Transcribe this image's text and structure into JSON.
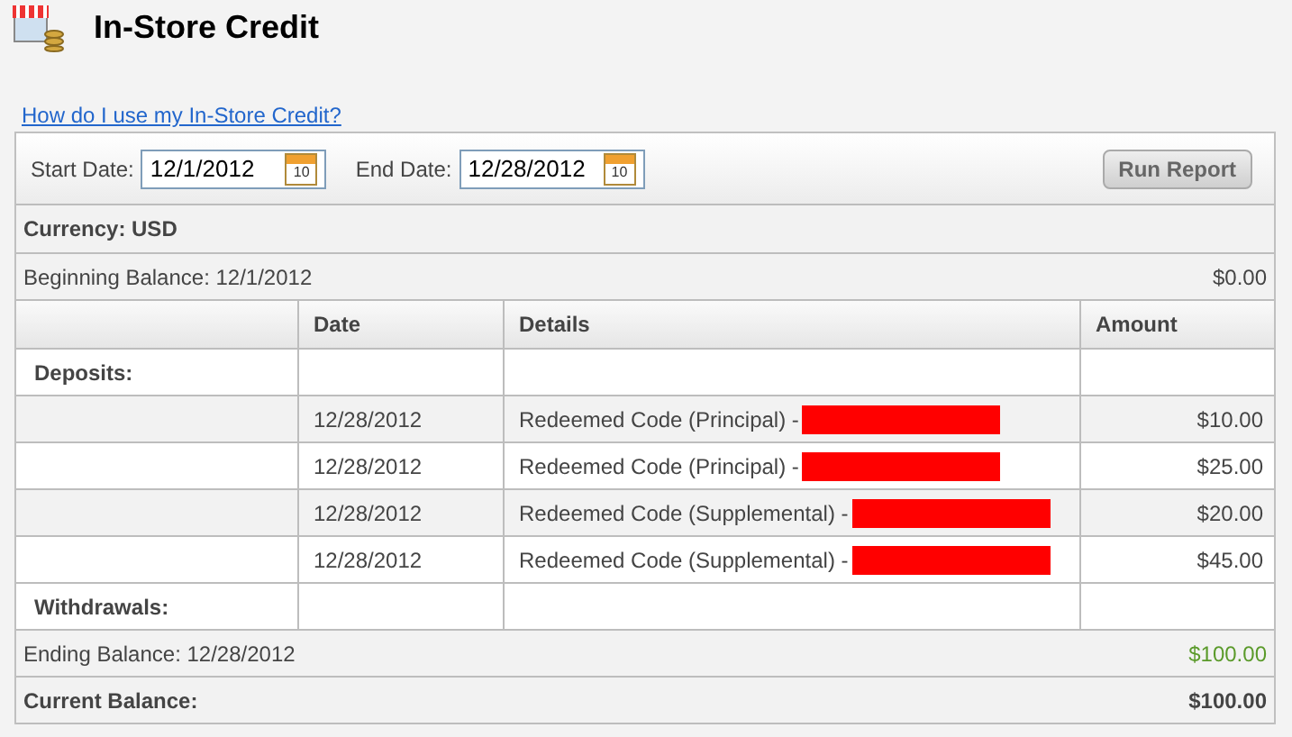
{
  "page": {
    "title": "In-Store Credit",
    "help_link": "How do I use my In-Store Credit?"
  },
  "filters": {
    "start_label": "Start Date:",
    "start_value": "12/1/2012",
    "start_calendar": "10",
    "end_label": "End Date:",
    "end_value": "12/28/2012",
    "end_calendar": "10",
    "button": "Run Report"
  },
  "currency": "Currency: USD",
  "beginning": {
    "label": "Beginning Balance: 12/1/2012",
    "amount": "$0.00"
  },
  "table": {
    "columns": [
      "Date",
      "Details",
      "Amount"
    ],
    "deposits_label": "Deposits:",
    "rows": [
      {
        "date": "12/28/2012",
        "details": "Redeemed Code (Principal) -",
        "redacted": true,
        "amount": "$10.00"
      },
      {
        "date": "12/28/2012",
        "details": "Redeemed Code (Principal) -",
        "redacted": true,
        "amount": "$25.00"
      },
      {
        "date": "12/28/2012",
        "details": "Redeemed Code (Supplemental) -",
        "redacted": true,
        "amount": "$20.00"
      },
      {
        "date": "12/28/2012",
        "details": "Redeemed Code (Supplemental) -",
        "redacted": true,
        "amount": "$45.00"
      }
    ],
    "withdrawals_label": "Withdrawals:"
  },
  "ending": {
    "label": "Ending Balance: 12/28/2012",
    "amount": "$100.00"
  },
  "current": {
    "label": "Current Balance:",
    "amount": "$100.00"
  }
}
